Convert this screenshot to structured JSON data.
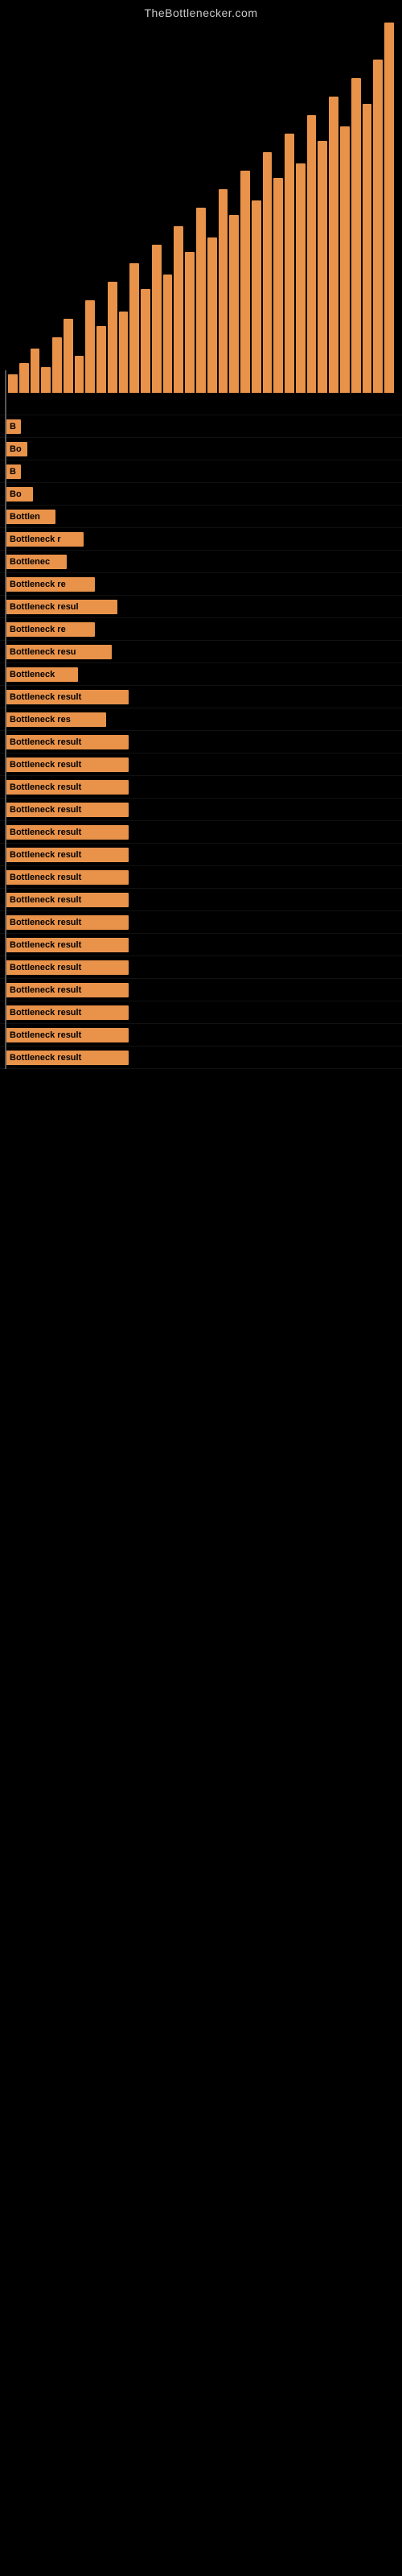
{
  "site": {
    "title": "TheBottlenecker.com"
  },
  "chart": {
    "bars": [
      {
        "height": 5
      },
      {
        "height": 8
      },
      {
        "height": 12
      },
      {
        "height": 7
      },
      {
        "height": 15
      },
      {
        "height": 20
      },
      {
        "height": 10
      },
      {
        "height": 25
      },
      {
        "height": 18
      },
      {
        "height": 30
      },
      {
        "height": 22
      },
      {
        "height": 35
      },
      {
        "height": 28
      },
      {
        "height": 40
      },
      {
        "height": 32
      },
      {
        "height": 45
      },
      {
        "height": 38
      },
      {
        "height": 50
      },
      {
        "height": 42
      },
      {
        "height": 55
      },
      {
        "height": 48
      },
      {
        "height": 60
      },
      {
        "height": 52
      },
      {
        "height": 65
      },
      {
        "height": 58
      },
      {
        "height": 70
      },
      {
        "height": 62
      },
      {
        "height": 75
      },
      {
        "height": 68
      },
      {
        "height": 80
      },
      {
        "height": 72
      },
      {
        "height": 85
      },
      {
        "height": 78
      },
      {
        "height": 90
      },
      {
        "height": 100
      }
    ]
  },
  "results": [
    {
      "label": "",
      "width": 2
    },
    {
      "label": "B",
      "width": 4
    },
    {
      "label": "Bo",
      "width": 8
    },
    {
      "label": "B",
      "width": 5
    },
    {
      "label": "Bo",
      "width": 10
    },
    {
      "label": "Bottlen",
      "width": 18
    },
    {
      "label": "Bottleneck r",
      "width": 28
    },
    {
      "label": "Bottlenec",
      "width": 22
    },
    {
      "label": "Bottleneck re",
      "width": 32
    },
    {
      "label": "Bottleneck resul",
      "width": 40
    },
    {
      "label": "Bottleneck re",
      "width": 32
    },
    {
      "label": "Bottleneck resu",
      "width": 38
    },
    {
      "label": "Bottleneck",
      "width": 26
    },
    {
      "label": "Bottleneck result",
      "width": 44
    },
    {
      "label": "Bottleneck res",
      "width": 36
    },
    {
      "label": "Bottleneck result",
      "width": 44
    },
    {
      "label": "Bottleneck result",
      "width": 44
    },
    {
      "label": "Bottleneck result",
      "width": 44
    },
    {
      "label": "Bottleneck result",
      "width": 44
    },
    {
      "label": "Bottleneck result",
      "width": 44
    },
    {
      "label": "Bottleneck result",
      "width": 44
    },
    {
      "label": "Bottleneck result",
      "width": 44
    },
    {
      "label": "Bottleneck result",
      "width": 44
    },
    {
      "label": "Bottleneck result",
      "width": 44
    },
    {
      "label": "Bottleneck result",
      "width": 44
    },
    {
      "label": "Bottleneck result",
      "width": 44
    },
    {
      "label": "Bottleneck result",
      "width": 44
    },
    {
      "label": "Bottleneck result",
      "width": 44
    },
    {
      "label": "Bottleneck result",
      "width": 44
    },
    {
      "label": "Bottleneck result",
      "width": 44
    }
  ]
}
